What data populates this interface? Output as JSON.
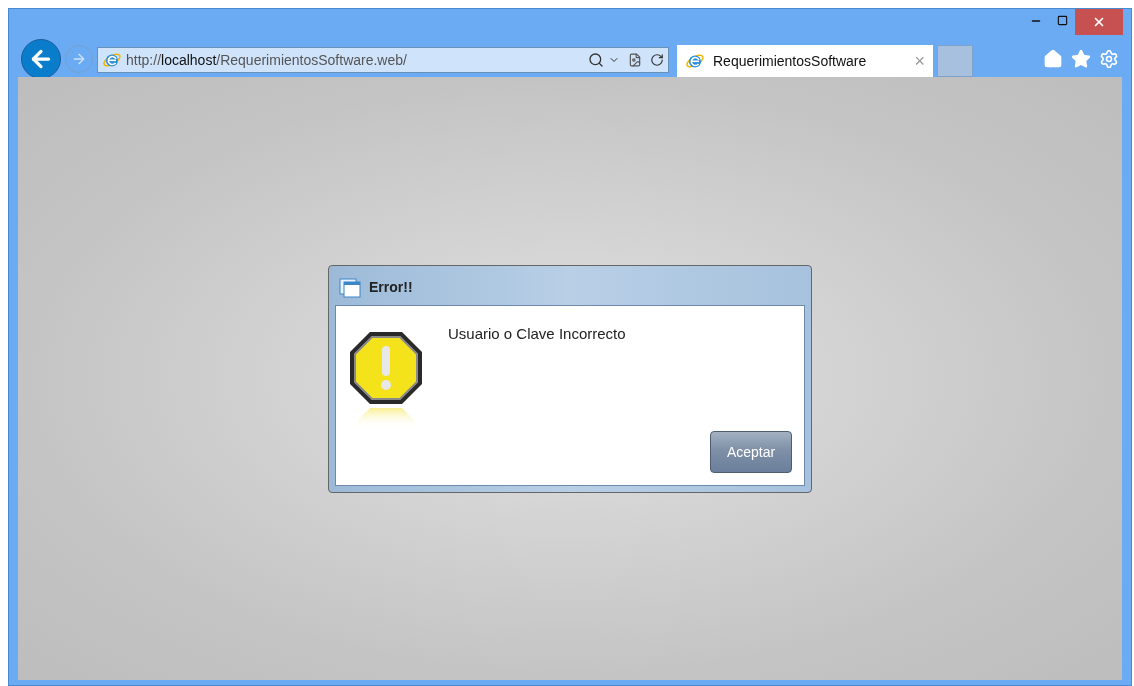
{
  "address_bar": {
    "scheme": "http://",
    "host": "localhost",
    "path": "/RequerimientosSoftware.web/"
  },
  "tabs": [
    {
      "label": "RequerimientosSoftware",
      "selected": true
    }
  ],
  "tab_close": "×",
  "dialog": {
    "title": "Error!!",
    "message": "Usuario o Clave Incorrecto",
    "button": "Aceptar"
  }
}
